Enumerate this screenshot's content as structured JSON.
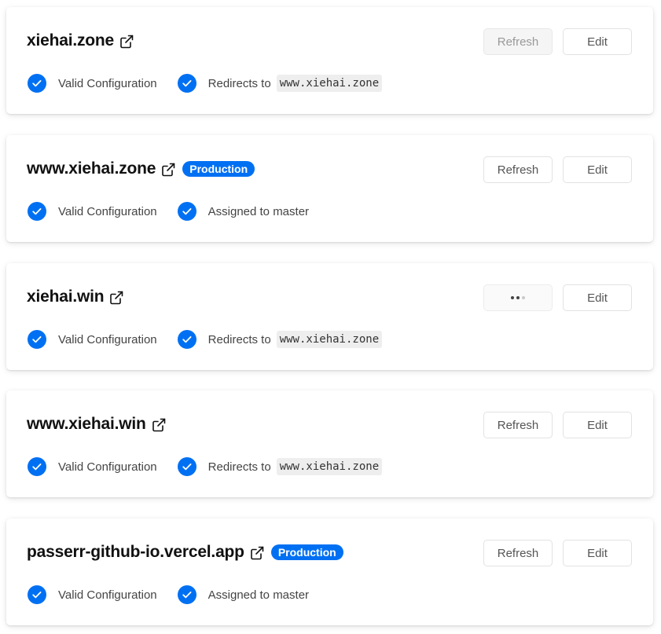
{
  "colors": {
    "accent": "#0070f3",
    "check": "#0070f3",
    "code_bg": "#eeeeee"
  },
  "domains": [
    {
      "name": "xiehai.zone",
      "badge": "",
      "refresh": {
        "label": "Refresh",
        "state": "disabled"
      },
      "edit_label": "Edit",
      "config_status": "Valid Configuration",
      "routing_text": "Redirects to",
      "redirect_target": "www.xiehai.zone",
      "icons": {
        "external": "external-link-icon",
        "check": "check-circle-icon"
      }
    },
    {
      "name": "www.xiehai.zone",
      "badge": "Production",
      "refresh": {
        "label": "Refresh",
        "state": "normal"
      },
      "edit_label": "Edit",
      "config_status": "Valid Configuration",
      "routing_text": "Assigned to master",
      "redirect_target": "",
      "icons": {
        "external": "external-link-icon",
        "check": "check-circle-icon"
      }
    },
    {
      "name": "xiehai.win",
      "badge": "",
      "refresh": {
        "label": "",
        "state": "loading"
      },
      "edit_label": "Edit",
      "config_status": "Valid Configuration",
      "routing_text": "Redirects to",
      "redirect_target": "www.xiehai.zone",
      "icons": {
        "external": "external-link-icon",
        "check": "check-circle-icon"
      }
    },
    {
      "name": "www.xiehai.win",
      "badge": "",
      "refresh": {
        "label": "Refresh",
        "state": "normal"
      },
      "edit_label": "Edit",
      "config_status": "Valid Configuration",
      "routing_text": "Redirects to",
      "redirect_target": "www.xiehai.zone",
      "icons": {
        "external": "external-link-icon",
        "check": "check-circle-icon"
      }
    },
    {
      "name": "passerr-github-io.vercel.app",
      "badge": "Production",
      "refresh": {
        "label": "Refresh",
        "state": "normal"
      },
      "edit_label": "Edit",
      "config_status": "Valid Configuration",
      "routing_text": "Assigned to master",
      "redirect_target": "",
      "icons": {
        "external": "external-link-icon",
        "check": "check-circle-icon"
      }
    }
  ]
}
